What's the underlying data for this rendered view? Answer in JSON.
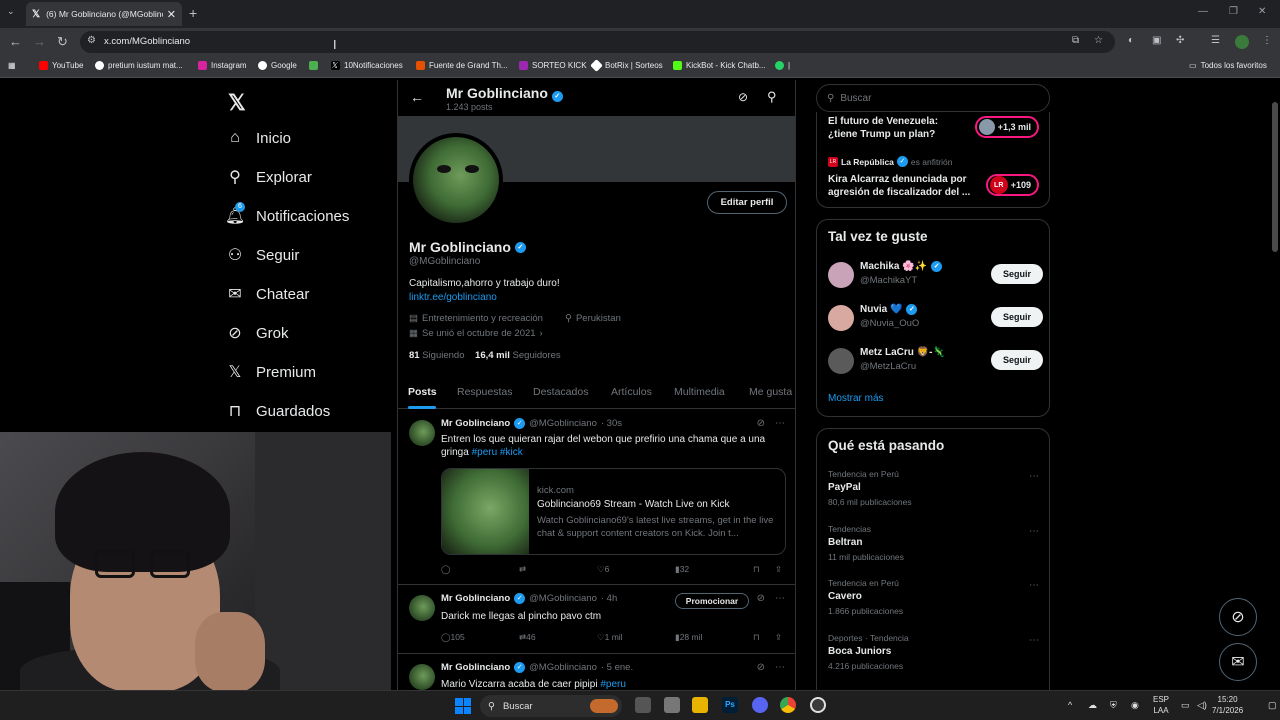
{
  "browser": {
    "tab_title": "(6) Mr Goblinciano (@MGoblinciano",
    "url": "x.com/MGoblinciano",
    "bookmarks": [
      "YouTube",
      "pretium iustum mat...",
      "Instagram",
      "Google",
      "",
      "10Notificaciones",
      "Fuente de Grand Th...",
      "SORTEO KICK",
      "BotRix | Sorteos",
      "KickBot - Kick Chatb..."
    ],
    "all_bookmarks": "Todos los favoritos"
  },
  "nav": {
    "items": [
      {
        "label": "Inicio",
        "icon": "home-icon"
      },
      {
        "label": "Explorar",
        "icon": "search-icon"
      },
      {
        "label": "Notificaciones",
        "icon": "bell-icon"
      },
      {
        "label": "Seguir",
        "icon": "follow-icon"
      },
      {
        "label": "Chatear",
        "icon": "mail-icon"
      },
      {
        "label": "Grok",
        "icon": "grok-icon"
      },
      {
        "label": "Premium",
        "icon": "x-icon"
      },
      {
        "label": "Guardados",
        "icon": "bookmark-icon"
      }
    ],
    "notif_badge": "6"
  },
  "profile": {
    "header_name": "Mr Goblinciano",
    "header_posts": "1.243 posts",
    "edit_label": "Editar perfil",
    "name": "Mr Goblinciano",
    "handle": "@MGoblinciano",
    "bio": "Capitalismo,ahorro y trabajo duro!",
    "link": "linktr.ee/goblinciano",
    "category": "Entretenimiento y recreación",
    "location": "Perukistan",
    "joined": "Se unió el octubre de 2021",
    "following_count": "81",
    "following_label": "Siguiendo",
    "followers_count": "16,4 mil",
    "followers_label": "Seguidores",
    "tabs": [
      "Posts",
      "Respuestas",
      "Destacados",
      "Artículos",
      "Multimedia",
      "Me gusta"
    ]
  },
  "tweets": [
    {
      "name": "Mr Goblinciano",
      "handle": "@MGoblinciano",
      "time": "· 30s",
      "text": "Entren los que quieran rajar del webon que prefirio una chama que a una gringa ",
      "tags": "#peru #kick",
      "card": {
        "domain": "kick.com",
        "title": "Goblinciano69 Stream - Watch Live on Kick",
        "desc": "Watch Goblinciano69's latest live streams, get in the live chat & support content creators on Kick. Join t..."
      },
      "replies": "",
      "retweets": "",
      "likes": "6",
      "views": "32"
    },
    {
      "name": "Mr Goblinciano",
      "handle": "@MGoblinciano",
      "time": "· 4h",
      "text": "Darick me llegas al pincho pavo ctm",
      "promote": "Promocionar",
      "replies": "105",
      "retweets": "46",
      "likes": "1 mil",
      "views": "28 mil"
    },
    {
      "name": "Mr Goblinciano",
      "handle": "@MGoblinciano",
      "time": "· 5 ene.",
      "text": "Mario Vizcarra acaba de caer pipipi ",
      "tags": "#peru"
    }
  ],
  "right": {
    "search_placeholder": "Buscar",
    "news": [
      {
        "title": "El futuro de Venezuela: ¿tiene Trump un plan?",
        "count": "+1,3 mil"
      },
      {
        "source": "La República",
        "host": "es anfitrión",
        "title": "Kira Alcarraz denunciada por agresión de fiscalizador del ...",
        "count": "+109",
        "badge": "LR"
      }
    ],
    "who_title": "Tal vez te guste",
    "who": [
      {
        "name": "Machika 🌸✨",
        "handle": "@MachikaYT",
        "button": "Seguir"
      },
      {
        "name": "Nuvia 💙",
        "handle": "@Nuvia_OuO",
        "button": "Seguir"
      },
      {
        "name": "Metz LaCru 🦁-🦎",
        "handle": "@MetzLaCru",
        "button": "Seguir"
      }
    ],
    "more": "Mostrar más",
    "trends_title": "Qué está pasando",
    "trends": [
      {
        "context": "Tendencia en Perú",
        "name": "PayPal",
        "posts": "80,6 mil publicaciones"
      },
      {
        "context": "Tendencias",
        "name": "Beltran",
        "posts": "11 mil publicaciones"
      },
      {
        "context": "Tendencia en Perú",
        "name": "Cavero",
        "posts": "1.866 publicaciones"
      },
      {
        "context": "Deportes · Tendencia",
        "name": "Boca Juniors",
        "posts": "4.216 publicaciones"
      }
    ]
  },
  "taskbar": {
    "search": "Buscar",
    "lang1": "ESP",
    "lang2": "LAA",
    "time": "15:20",
    "date": "7/1/2026"
  },
  "colors": {
    "accent": "#1d9bf0",
    "border": "#2f3336",
    "muted": "#71767b",
    "live": "#f91880"
  }
}
